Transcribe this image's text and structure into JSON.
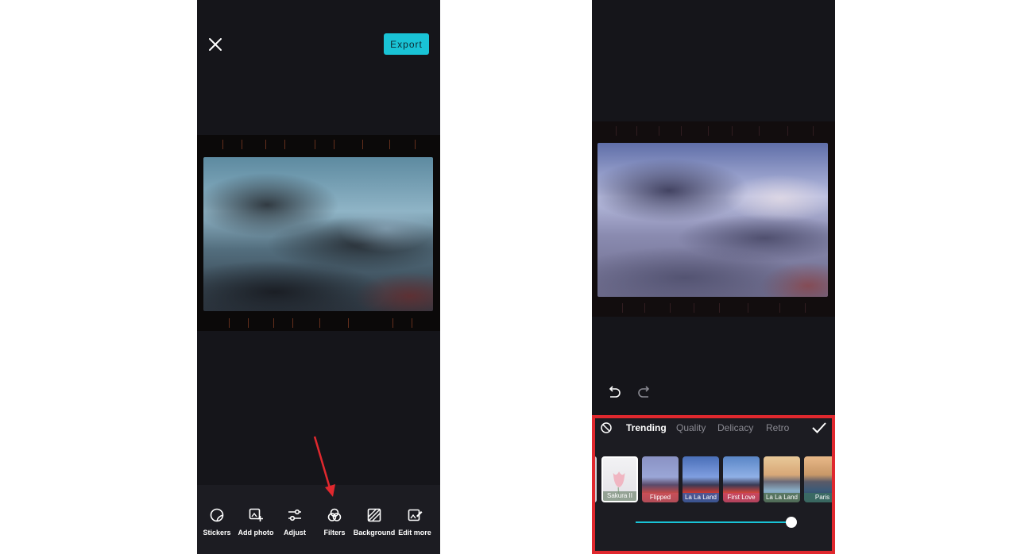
{
  "left_screen": {
    "export_label": "Export",
    "toolbar": [
      {
        "label": "Stickers",
        "icon": "sticker-icon"
      },
      {
        "label": "Add photo",
        "icon": "add-photo-icon"
      },
      {
        "label": "Adjust",
        "icon": "adjust-sliders-icon"
      },
      {
        "label": "Filters",
        "icon": "filters-icon"
      },
      {
        "label": "Background",
        "icon": "background-icon"
      },
      {
        "label": "Edit more",
        "icon": "edit-more-icon"
      }
    ]
  },
  "right_screen": {
    "filter_tabs": [
      "Trending",
      "Quality",
      "Delicacy",
      "Retro"
    ],
    "active_tab": "Trending",
    "filters": [
      {
        "label": "Sakura II",
        "selected": true
      },
      {
        "label": "Flipped",
        "selected": false
      },
      {
        "label": "La La Land",
        "selected": false
      },
      {
        "label": "First Love",
        "selected": false
      },
      {
        "label": "La La Land",
        "selected": false
      },
      {
        "label": "Paris",
        "selected": false
      }
    ],
    "intensity_fraction": 1.0
  },
  "colors": {
    "accent": "#19c3d6",
    "background": "#15151a",
    "highlight": "#e0282e",
    "annotation_arrow": "#e0282e"
  }
}
